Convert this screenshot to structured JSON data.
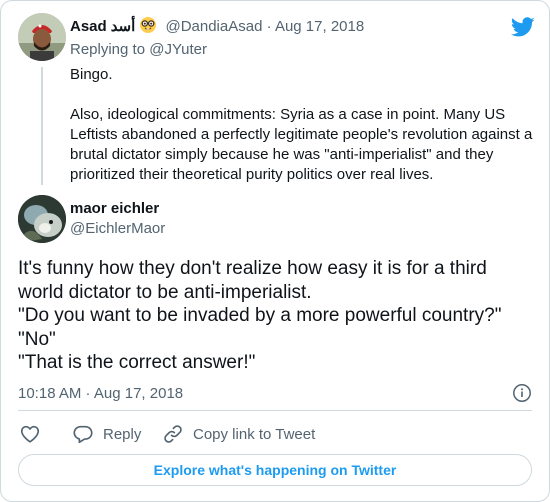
{
  "parent_tweet": {
    "author_name": "Asad",
    "author_name_arabic": "أسد",
    "author_emoji_icon": "nerd-face-emoji",
    "handle": "@DandiaAsad",
    "separator": "·",
    "date": "Aug 17, 2018",
    "replying_prefix": "Replying to",
    "replying_to": "@JYuter",
    "paragraphs": [
      "Bingo.",
      "Also, ideological commitments: Syria as a case in point. Many US Leftists abandoned a perfectly legitimate people's revolution against a brutal dictator simply because he was \"anti-imperialist\" and they prioritized their theoretical purity politics over real lives."
    ]
  },
  "main_tweet": {
    "author_name": "maor eichler",
    "handle": "@EichlerMaor",
    "text_lines": [
      "It's funny how they don't realize how easy it is for a third",
      "world dictator to be anti-imperialist.",
      "\"Do you want to be invaded by a more powerful country?\"",
      "\"No\"",
      "\"That is the correct answer!\""
    ],
    "timestamp": "10:18 AM · Aug 17, 2018"
  },
  "actions": {
    "like_icon": "heart-icon",
    "reply_icon": "reply-bubble-icon",
    "reply_label": "Reply",
    "copy_icon": "link-icon",
    "copy_label": "Copy link to Tweet"
  },
  "explore_label": "Explore what's happening on Twitter",
  "colors": {
    "brand_blue": "#1d9bf0",
    "text_primary": "#0f1419",
    "text_secondary": "#536471",
    "border": "#cfd9de"
  }
}
